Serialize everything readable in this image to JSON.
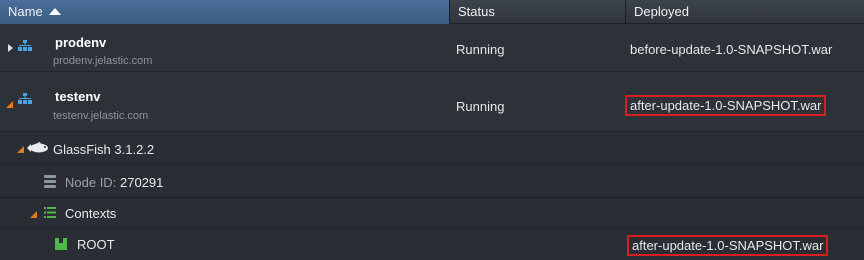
{
  "columns": {
    "name": "Name",
    "status": "Status",
    "deployed": "Deployed"
  },
  "environments": [
    {
      "name": "prodenv",
      "domain": "prodenv.jelastic.com",
      "status": "Running",
      "deployed": "before-update-1.0-SNAPSHOT.war",
      "expanded": false
    },
    {
      "name": "testenv",
      "domain": "testenv.jelastic.com",
      "status": "Running",
      "deployed": "after-update-1.0-SNAPSHOT.war",
      "expanded": true
    }
  ],
  "server": {
    "name": "GlassFish 3.1.2.2"
  },
  "node": {
    "label": "Node ID:",
    "id": "270291"
  },
  "contexts": {
    "label": "Contexts"
  },
  "root": {
    "name": "ROOT",
    "deployed": "after-update-1.0-SNAPSHOT.war"
  },
  "colors": {
    "header_active": "#4a6f99",
    "highlight_border": "#d81e1e",
    "expand_arrow": "#e07b1e",
    "node_icon": "#4aa3df",
    "context_icon": "#4fb848"
  }
}
